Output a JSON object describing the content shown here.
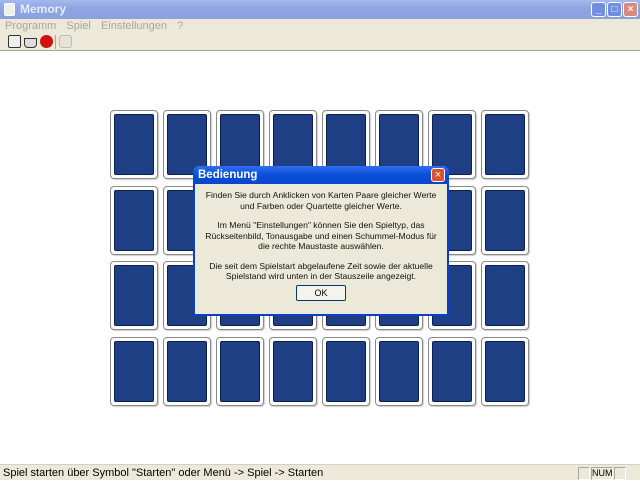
{
  "window": {
    "title": "Memory",
    "minimize": "_",
    "maximize": "□",
    "close": "×"
  },
  "menu": [
    "Programm",
    "Spiel",
    "Einstellungen",
    "?"
  ],
  "toolbar": [
    "new-game-icon",
    "print-icon",
    "stop-icon",
    "statistics-icon"
  ],
  "board": {
    "rows": 4,
    "cols": 8,
    "card_back_color": "#1f3f84"
  },
  "dialog": {
    "title": "Bedienung",
    "paragraphs": [
      "Finden Sie durch Anklicken von Karten Paare  gleicher Werte und Farben oder Quartette gleicher Werte.",
      "Im Menü \"Einstellungen\" können Sie den Spieltyp, das Rückseitenbild, Tonausgabe und einen Schummel-Modus für die rechte Maustaste auswählen.",
      "Die seit dem Spielstart abgelaufene Zeit sowie der aktuelle Spielstand wird unten in der Stauszeile angezeigt."
    ],
    "ok": "OK",
    "close": "×"
  },
  "status": {
    "text": "Spiel starten über Symbol \"Starten\" oder Menü -> Spiel -> Starten",
    "num": "NUM"
  }
}
